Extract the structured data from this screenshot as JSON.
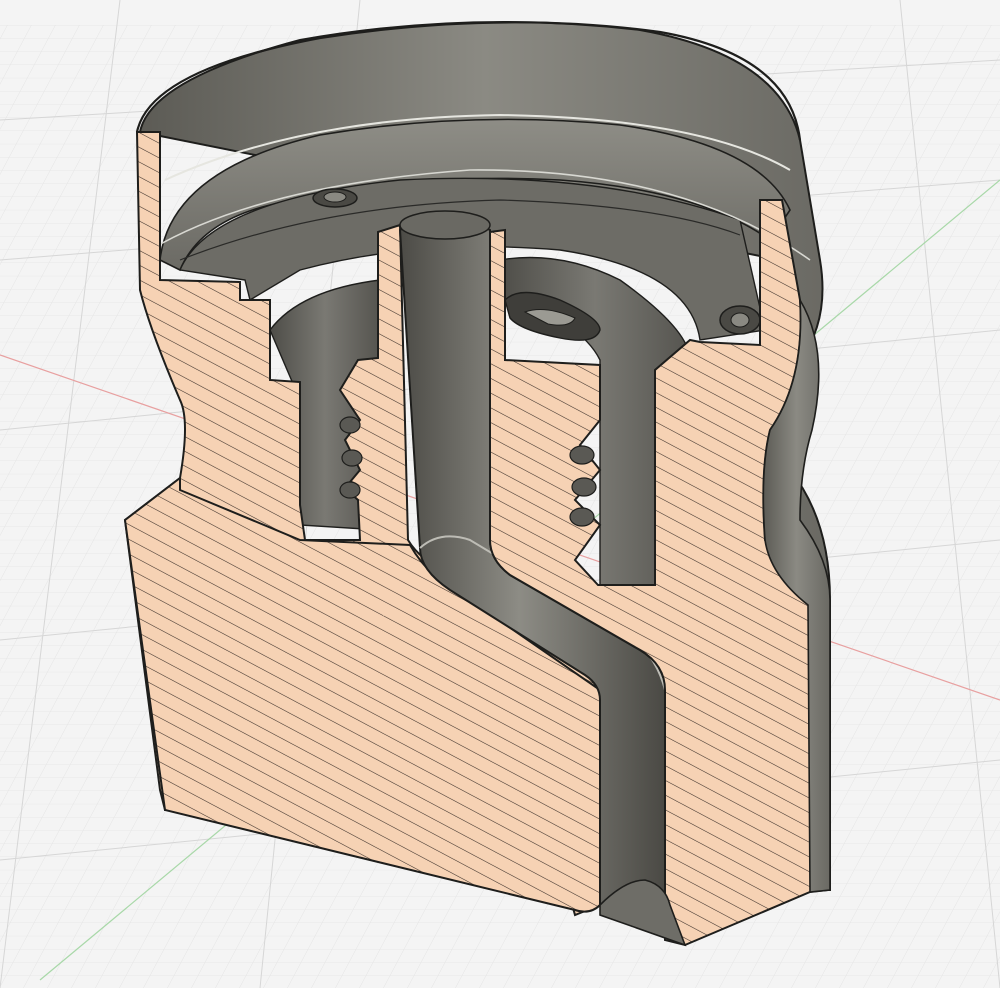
{
  "colors": {
    "background": "#f4f4f4",
    "grid_minor": "#e3e3e3",
    "grid_major": "#d2d2d2",
    "axis_red": "#e8a0a0",
    "axis_green": "#a8d8a8",
    "section_fill": "#f6d2b4",
    "hatch": "#3a2e28",
    "body_dark": "#55554f",
    "body_mid": "#77766f",
    "body_light": "#9a9992",
    "edge": "#1e1e1c"
  },
  "icons": {
    "viewport": "cad-3d-viewport",
    "part": "section-analysis-part"
  }
}
